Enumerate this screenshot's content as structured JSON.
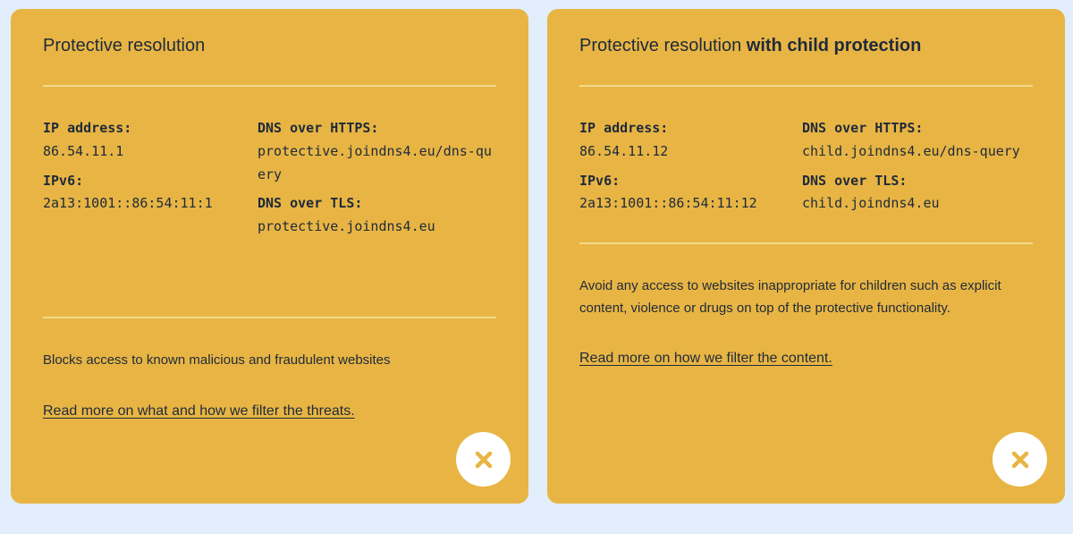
{
  "cards": [
    {
      "title_plain": "Protective resolution",
      "title_bold": "",
      "ip_label": "IP address:",
      "ip_value": "86.54.11.1",
      "ipv6_label": "IPv6:",
      "ipv6_value": "2a13:1001::86:54:11:1",
      "doh_label": "DNS over HTTPS:",
      "doh_value": "protective.joindns4.eu/dns-query",
      "dot_label": "DNS over TLS:",
      "dot_value": "protective.joindns4.eu",
      "description": "Blocks access to known malicious and fraudulent websites",
      "link": "Read more on what and how we filter the threats.",
      "close_icon": "close-x-icon"
    },
    {
      "title_plain": "Protective resolution ",
      "title_bold": "with child protection",
      "ip_label": "IP address:",
      "ip_value": "86.54.11.12",
      "ipv6_label": "IPv6:",
      "ipv6_value": "2a13:1001::86:54:11:12",
      "doh_label": "DNS over HTTPS:",
      "doh_value": "child.joindns4.eu/dns-query",
      "dot_label": "DNS over TLS:",
      "dot_value": "child.joindns4.eu",
      "description": "Avoid any access to websites inappropriate for children such as explicit content, violence or drugs on top of the protective functionality.",
      "link": "Read more on how we filter the content.",
      "close_icon": "close-x-icon"
    }
  ],
  "colors": {
    "background": "#e2eefb",
    "card": "#e8b544",
    "divider": "#f3d98c",
    "text": "#1f2a3a",
    "close_button": "#ffffff"
  }
}
